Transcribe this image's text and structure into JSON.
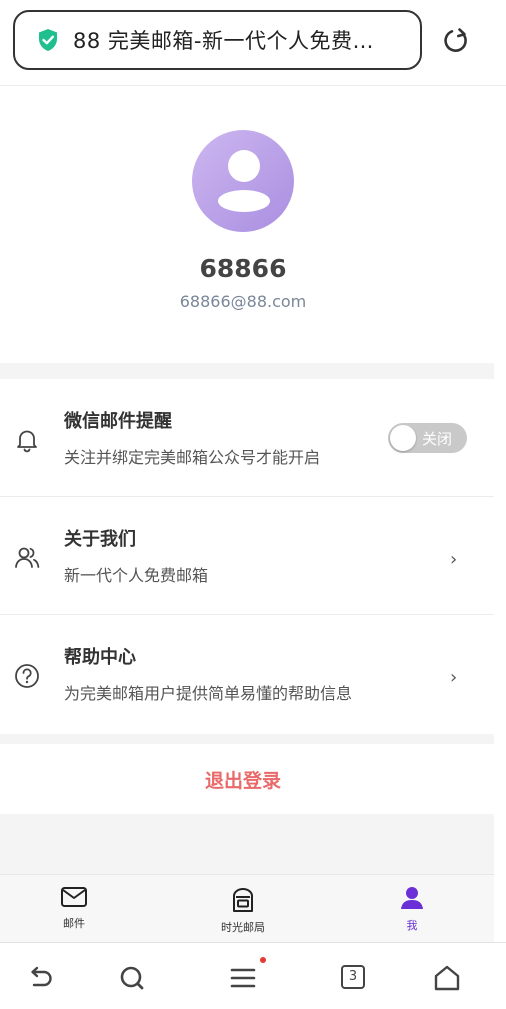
{
  "browser": {
    "url_title": "88 完美邮箱-新一代个人免费…",
    "tab_count": "3"
  },
  "profile": {
    "username": "68866",
    "email": "68866@88.com"
  },
  "settings": [
    {
      "title": "微信邮件提醒",
      "desc": "关注并绑定完美邮箱公众号才能开启",
      "control": "toggle",
      "toggle_label": "关闭",
      "toggle_on": false
    },
    {
      "title": "关于我们",
      "desc": "新一代个人免费邮箱",
      "control": "chevron",
      "chevron": "›"
    },
    {
      "title": "帮助中心",
      "desc": "为完美邮箱用户提供简单易懂的帮助信息",
      "control": "chevron",
      "chevron": "›"
    }
  ],
  "logout_label": "退出登录",
  "tabs": [
    {
      "label": "邮件",
      "icon": "mail-icon"
    },
    {
      "label": "时光邮局",
      "icon": "mailbox-icon"
    },
    {
      "label": "我",
      "icon": "user-icon",
      "active": true
    }
  ],
  "colors": {
    "accent": "#6a2fd6",
    "logout": "#e86a6a",
    "shield": "#1fbf8f"
  }
}
